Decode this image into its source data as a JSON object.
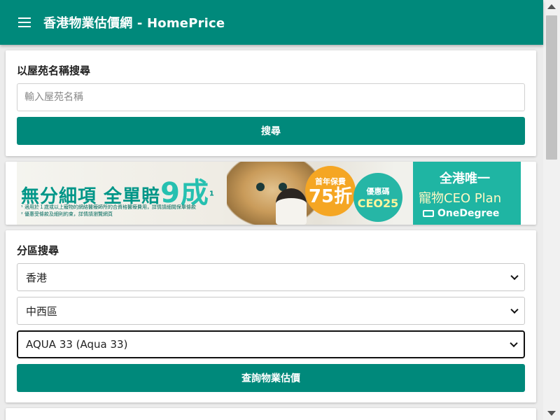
{
  "header": {
    "title": "香港物業估價網 - HomePrice",
    "menu_icon": "hamburger-menu-icon",
    "background_color": "#00897b"
  },
  "name_search": {
    "title": "以屋苑名稱搜尋",
    "input_placeholder": "輸入屋苑名稱",
    "input_value": "",
    "button_label": "搜尋"
  },
  "ad": {
    "headline": "無分細項 全單賠",
    "headline_big": "9成",
    "headline_sup": "1",
    "fine_print_1": "¹ 適用於１歲或以上寵物的網絡醫療師所的合資格醫療費用，詳情請細閱保單條款",
    "fine_print_2": "² 優惠受條款及細則約束，詳情請瀏覽網頁",
    "badge_small": "首年保費",
    "badge_big": "75折",
    "coupon_small": "優惠碼",
    "coupon_code": "CEO25",
    "right_line1": "全港唯一",
    "right_line2": "寵物CEO Plan",
    "brand": "OneDegree",
    "accent_color": "#009688"
  },
  "district_search": {
    "title": "分區搜尋",
    "region_select": "香港",
    "district_select": "中西區",
    "estate_select": "AQUA 33 (Aqua 33)",
    "button_label": "查詢物業估價",
    "dropdown_icon": "chevron-down-icon"
  },
  "scrollbar": {
    "up_icon": "scroll-up-arrow-icon",
    "down_icon": "scroll-down-arrow-icon"
  }
}
